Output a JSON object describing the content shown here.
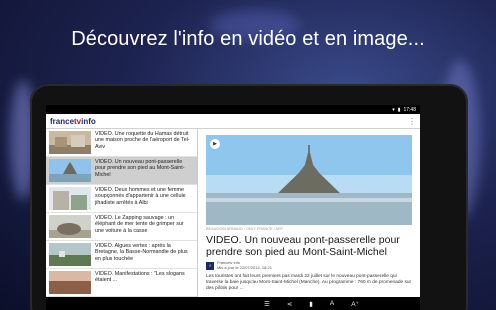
{
  "promo": {
    "headline": "Découvrez l'info en vidéo et en image..."
  },
  "status": {
    "time": "17:48"
  },
  "appbar": {
    "logo_prefix": "france",
    "logo_accent": "tv",
    "logo_suffix": "info",
    "overflow": "⋮"
  },
  "list": {
    "items": [
      {
        "text": "VIDEO. Une roquette du Hamas détruit une maison proche de l'aéroport de Tel-Aviv",
        "active": false
      },
      {
        "text": "VIDEO. Un nouveau pont-passerelle pour prendre son pied au Mont-Saint-Michel",
        "active": true
      },
      {
        "text": "VIDEO. Deux hommes et une femme soupçonnés d'appartenir à une cellule jihadiste arrêtés à Albi",
        "active": false
      },
      {
        "text": "VIDEO. Le Zapping sauvage : un éléphant de mer tente de grimper sur une voiture à la casse",
        "active": false
      },
      {
        "text": "VIDEO. Algues vertes : après la Bretagne, la Basse-Normandie de plus en plus touchée",
        "active": false
      },
      {
        "text": "VIDEO. Manifestations : \"Les slogans étaient ...",
        "active": false
      }
    ]
  },
  "article": {
    "credit": "BEAUDOIN ARNAUD / ONLY FRANCE / AFP",
    "title": "VIDEO. Un nouveau pont-passerelle pour prendre son pied au Mont-Saint-Michel",
    "source": "Francetv info",
    "date": "Mis à jour le 22/07/2014, 18:21",
    "body": "Les touristes ont fait leurs premiers pas mardi 22 juillet sur le nouveau pont-passerelle qui traverse la baie jusqu'au Mont-Saint-Michel (Manche). Au programme : 760 m de promenade sur des pilotis pour ..."
  }
}
